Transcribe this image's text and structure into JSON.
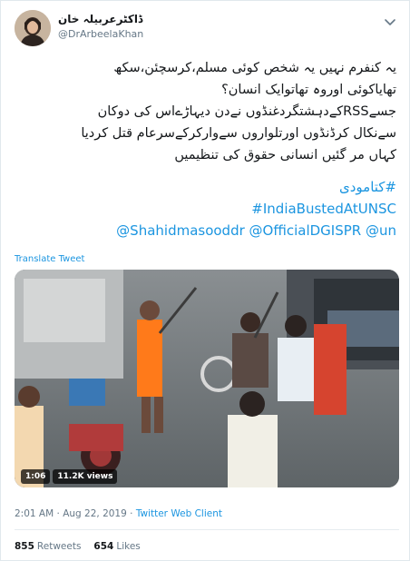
{
  "author": {
    "display_name": "ڈاکٹرعربیلہ خان",
    "handle": "@DrArbeelaKhan"
  },
  "tweet": {
    "lines": [
      "یہ کنفرم نہیں  یہ شخص کوئی  مسلم،کرسچئن،سکھ",
      "تھایاکوئی اوروہ  تھاتوایک انسان؟",
      "جسےRSSکےدہشتگردغنڈوں نےدن  دیہاڑےاس کی دوکان",
      "سےنکال کرڈنڈوں اورتلواروں  سےوارکرکےسرعام قتل کردیا",
      "کہاں مر گئیں انسانی حقوق کی تنظیمیں"
    ],
    "hashtag_urdu": "#کتامودی",
    "hashtag_english": "#IndiaBustedAtUNSC",
    "mentions": "@Shahidmasooddr @OfficialDGISPR @un",
    "translate_label": "Translate Tweet"
  },
  "media": {
    "duration": "1:06",
    "views": "11.2K views"
  },
  "meta": {
    "time": "2:01 AM",
    "separator": " · ",
    "date": "Aug 22, 2019",
    "client": "Twitter Web Client"
  },
  "stats": {
    "retweets_count": "855",
    "retweets_label": "Retweets",
    "likes_count": "654",
    "likes_label": "Likes"
  },
  "colors": {
    "link": "#1b95e0",
    "secondary_text": "#657786",
    "primary_text": "#14171a"
  },
  "icons": {
    "caret": "chevron-down-icon"
  }
}
